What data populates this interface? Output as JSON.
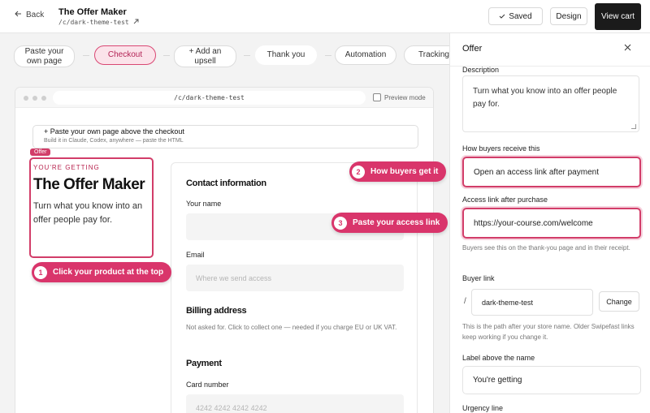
{
  "topbar": {
    "back_label": "Back",
    "title": "The Offer Maker",
    "path": "/c/dark-theme-test",
    "saved_label": "Saved",
    "design_label": "Design",
    "view_cart_label": "View cart"
  },
  "flow": {
    "steps": [
      {
        "label": "Paste your own page"
      },
      {
        "label": "Checkout"
      },
      {
        "label": "+ Add an upsell"
      },
      {
        "label": "Thank you"
      },
      {
        "label": "Automation"
      },
      {
        "label": "Tracking"
      }
    ]
  },
  "browser": {
    "url": "/c/dark-theme-test",
    "preview_mode_label": "Preview mode"
  },
  "paste_box": {
    "title": "+ Paste your own page above the checkout",
    "subtitle": "Build it in Claude, Codex, anywhere — paste the HTML"
  },
  "product": {
    "tag": "Offer",
    "eyebrow": "YOU'RE GETTING",
    "title": "The Offer Maker",
    "description": "Turn what you know into an offer people pay for."
  },
  "callouts": [
    {
      "number": "1",
      "text": "Click your product at the top"
    },
    {
      "number": "2",
      "text": "How buyers get it"
    },
    {
      "number": "3",
      "text": "Paste your access link"
    }
  ],
  "form": {
    "contact_heading": "Contact information",
    "name_label": "Your name",
    "email_label": "Email",
    "email_placeholder": "Where we send access",
    "billing_heading": "Billing address",
    "billing_note": "Not asked for. Click to collect one — needed if you charge EU or UK VAT.",
    "payment_heading": "Payment",
    "card_label": "Card number",
    "card_placeholder": "4242 4242 4242 4242"
  },
  "panel": {
    "title": "Offer",
    "description_label": "Description",
    "description_value": "Turn what you know into an offer people pay for.",
    "receive_label": "How buyers receive this",
    "receive_value": "Open an access link after payment",
    "access_label": "Access link after purchase",
    "access_value": "https://your-course.com/welcome",
    "access_note": "Buyers see this on the thank-you page and in their receipt.",
    "buyer_link_label": "Buyer link",
    "slash": "/",
    "slug_value": "dark-theme-test",
    "change_label": "Change",
    "slug_note": "This is the path after your store name. Older Swipefast links keep working if you change it.",
    "label_above_name_label": "Label above the name",
    "label_above_name_value": "You're getting",
    "urgency_label": "Urgency line"
  },
  "colors": {
    "accent": "#d23d69",
    "accent_soft": "#fbe3ea",
    "dark_button": "#1b1b1b"
  }
}
